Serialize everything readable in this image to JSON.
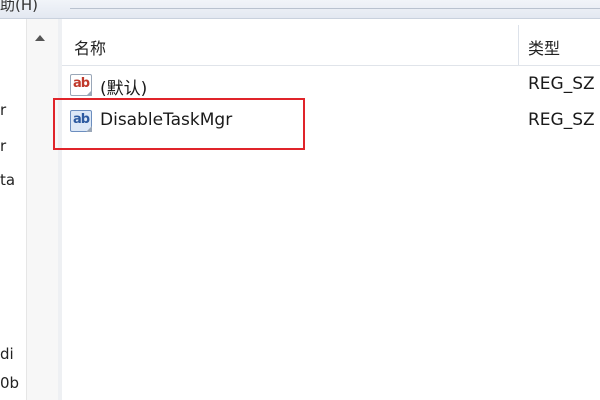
{
  "menubar": {
    "help_label": "助(H)"
  },
  "left_pane": {
    "fragments": [
      "r",
      "r",
      "ta",
      "di",
      "0b"
    ]
  },
  "list": {
    "columns": {
      "name": "名称",
      "type": "类型"
    },
    "rows": [
      {
        "name": "(默认)",
        "type": "REG_SZ",
        "icon": "ab-string-icon"
      },
      {
        "name": "DisableTaskMgr",
        "type": "REG_SZ",
        "icon": "ab-string-icon"
      }
    ],
    "icon_text": "ab"
  },
  "colors": {
    "highlight": "#e0242a"
  }
}
